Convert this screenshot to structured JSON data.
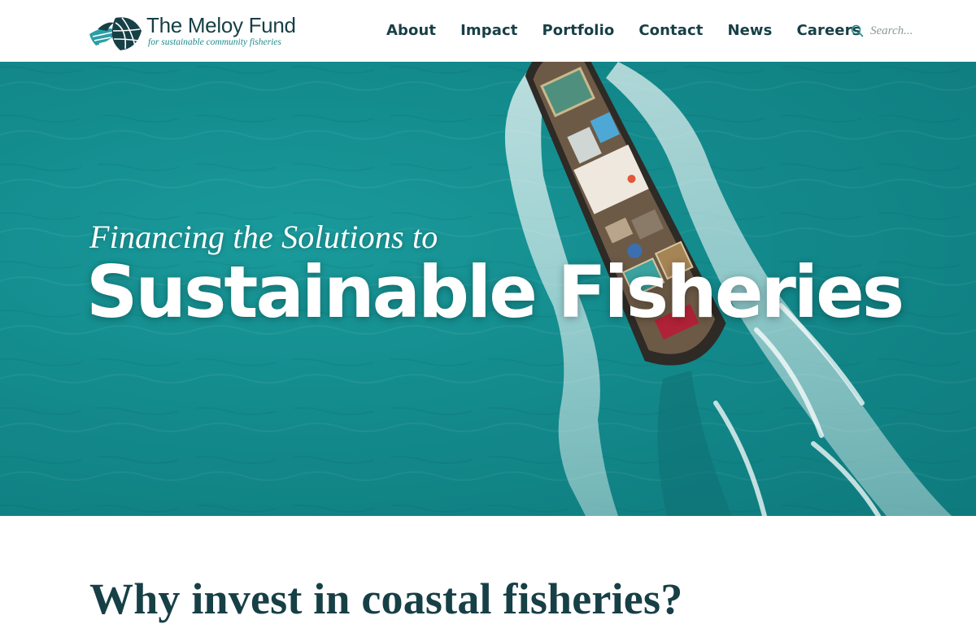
{
  "brand": {
    "name": "The Meloy Fund",
    "tagline": "for sustainable community fisheries",
    "logo_icon": "fishing-net-fish-mark"
  },
  "nav": {
    "items": [
      {
        "label": "About"
      },
      {
        "label": "Impact"
      },
      {
        "label": "Portfolio"
      },
      {
        "label": "Contact"
      },
      {
        "label": "News"
      },
      {
        "label": "Careers"
      }
    ]
  },
  "search": {
    "placeholder": "Search...",
    "icon": "search-icon"
  },
  "hero": {
    "subtitle": "Financing the Solutions to",
    "title": "Sustainable Fisheries",
    "image": "aerial view of a fishing boat on teal sea with white wake"
  },
  "section": {
    "heading": "Why invest in coastal fisheries?"
  },
  "colors": {
    "brand_dark": "#173f46",
    "brand_teal": "#1f8a8c",
    "sea": "#138a8c",
    "white": "#ffffff"
  }
}
